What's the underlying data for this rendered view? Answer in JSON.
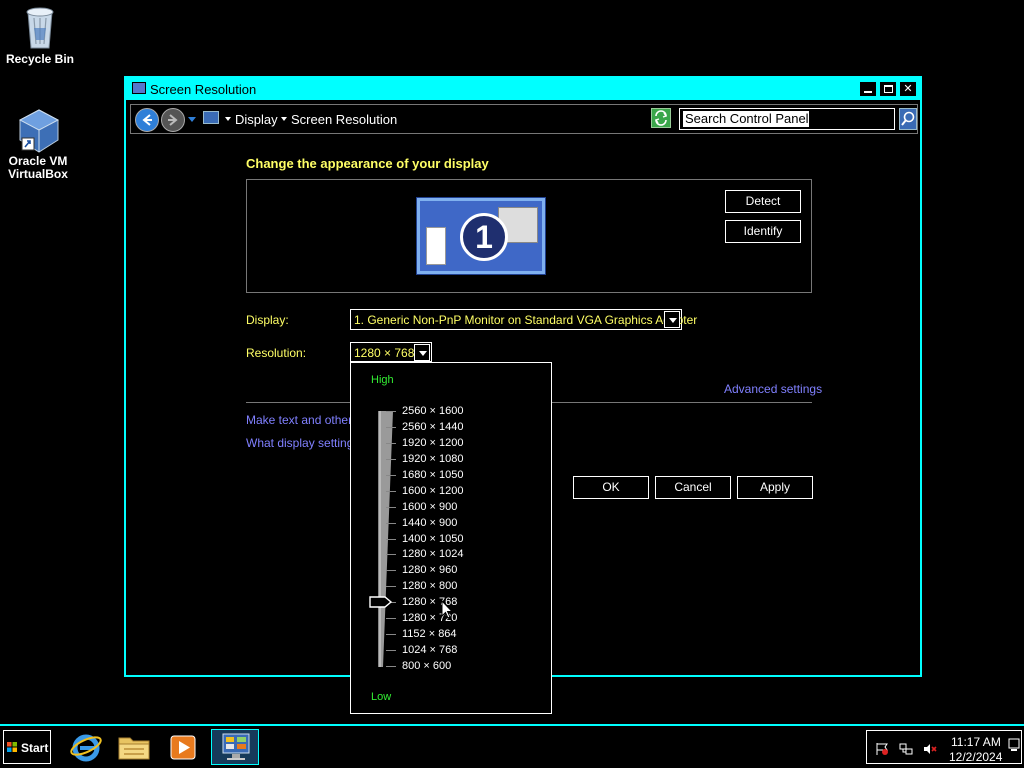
{
  "desktop": {
    "recycle_bin": "Recycle Bin",
    "vbox_line1": "Oracle VM",
    "vbox_line2": "VirtualBox"
  },
  "window": {
    "title": "Screen Resolution",
    "breadcrumb": [
      "Display",
      "Screen Resolution"
    ],
    "search_placeholder": "Search Control Panel"
  },
  "content": {
    "heading": "Change the appearance of your display",
    "monitor_number": "1",
    "detect_label": "Detect",
    "identify_label": "Identify",
    "display_label": "Display:",
    "display_value": "1. Generic Non-PnP Monitor on Standard VGA Graphics Adapter",
    "resolution_label": "Resolution:",
    "resolution_value": "1280 × 768",
    "advanced_link": "Advanced settings",
    "link_text_size": "Make text and other it",
    "link_what_settings": "What display settings s",
    "ok_label": "OK",
    "cancel_label": "Cancel",
    "apply_label": "Apply"
  },
  "resolution_popup": {
    "high_label": "High",
    "low_label": "Low",
    "options": [
      "2560 × 1600",
      "2560 × 1440",
      "1920 × 1200",
      "1920 × 1080",
      "1680 × 1050",
      "1600 × 1200",
      "1600 × 900",
      "1440 × 900",
      "1400 × 1050",
      "1280 × 1024",
      "1280 × 960",
      "1280 × 800",
      "1280 × 768",
      "1280 × 720",
      "1152 × 864",
      "1024 × 768",
      "800 × 600"
    ],
    "selected_index": 12
  },
  "taskbar": {
    "start_label": "Start",
    "time": "11:17 AM",
    "date": "12/2/2024"
  },
  "colors": {
    "accent": "#00ffff",
    "text_yellow": "#ffff66",
    "link": "#8080ff",
    "high_low": "#33ee33"
  },
  "icons": {
    "recycle": "recycle-bin-icon",
    "vbox": "virtualbox-icon",
    "back": "back-arrow-icon",
    "forward": "forward-arrow-icon",
    "refresh": "refresh-icon",
    "search": "search-icon",
    "ie": "internet-explorer-icon",
    "folder": "folder-icon",
    "media": "media-player-icon",
    "control_panel": "control-panel-icon"
  }
}
